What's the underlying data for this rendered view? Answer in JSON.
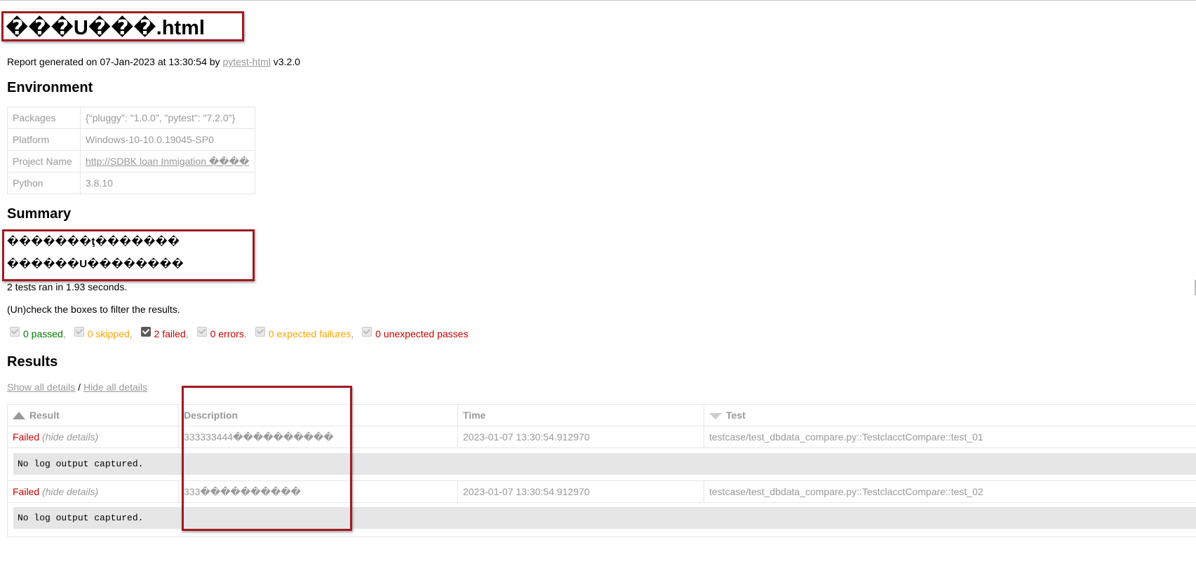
{
  "title": "���U���.html",
  "report": {
    "prefix": "Report generated on 07-Jan-2023 at 13:30:54 by ",
    "link": "pytest-html",
    "suffix": " v3.2.0"
  },
  "environment": {
    "heading": "Environment",
    "rows": [
      {
        "key": "Packages",
        "value": "{\"pluggy\": \"1.0.0\", \"pytest\": \"7.2.0\"}"
      },
      {
        "key": "Platform",
        "value": "Windows-10-10.0.19045-SP0"
      },
      {
        "key": "Project Name",
        "value": "http://SDBK loan Inmigation ����"
      },
      {
        "key": "Python",
        "value": "3.8.10"
      }
    ]
  },
  "summary": {
    "heading": "Summary",
    "garbled_line_1": "�������ţ�������",
    "garbled_line_2": "������U��������",
    "tests_ran": "2 tests ran in 1.93 seconds.",
    "filter_hint": "(Un)check the boxes to filter the results.",
    "filters": {
      "passed": "0 passed",
      "skipped": "0 skipped",
      "failed": "2 failed",
      "errors": "0 errors",
      "xfailed": "0 expected failures",
      "xpassed": "0 unexpected passes"
    }
  },
  "results": {
    "heading": "Results",
    "show_all": "Show all details",
    "slash": " / ",
    "hide_all": "Hide all details",
    "columns": {
      "result": "Result",
      "description": "Description",
      "time": "Time",
      "test": "Test"
    },
    "rows": [
      {
        "result": "Failed",
        "details": "(hide details)",
        "description": "333333444����������",
        "time": "2023-01-07 13:30:54.912970",
        "test": "testcase/test_dbdata_compare.py::TestclacctCompare::test_01",
        "log": "No log output captured."
      },
      {
        "result": "Failed",
        "details": "(hide details)",
        "description": "333����������",
        "time": "2023-01-07 13:30:54.912970",
        "test": "testcase/test_dbdata_compare.py::TestclacctCompare::test_02",
        "log": "No log output captured."
      }
    ]
  },
  "colors": {
    "passed": "#008000",
    "skipped": "#ffa500",
    "failed": "#cc0000",
    "annotation_box": "#a01c22",
    "muted": "#999999"
  }
}
